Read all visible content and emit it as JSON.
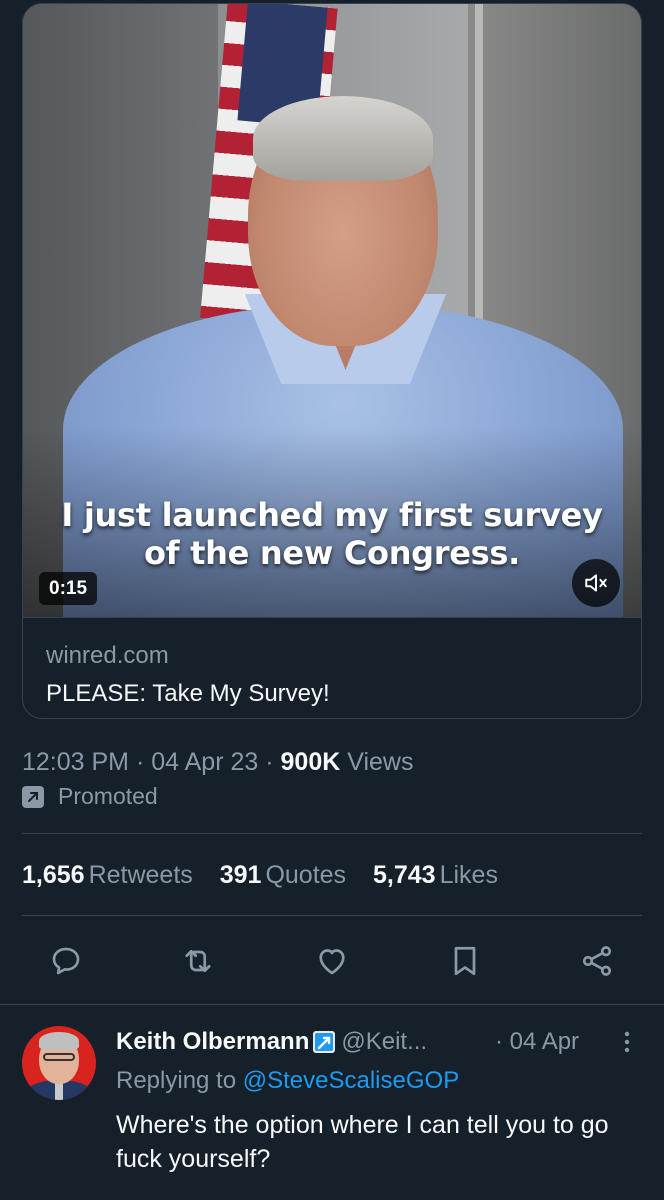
{
  "video": {
    "caption_line1": "I just launched my first survey",
    "caption_line2": "of the new Congress.",
    "duration": "0:15",
    "mute_icon": "speaker-muted-icon"
  },
  "link_card": {
    "domain": "winred.com",
    "title": "PLEASE: Take My Survey!"
  },
  "tweet_meta": {
    "time": "12:03 PM",
    "date": "04 Apr 23",
    "views_count": "900K",
    "views_label": "Views",
    "promoted_label": "Promoted"
  },
  "stats": [
    {
      "count": "1,656",
      "label": "Retweets"
    },
    {
      "count": "391",
      "label": "Quotes"
    },
    {
      "count": "5,743",
      "label": "Likes"
    }
  ],
  "actions": [
    "reply-icon",
    "retweet-icon",
    "like-icon",
    "bookmark-icon",
    "share-icon"
  ],
  "reply": {
    "name": "Keith Olbermann",
    "handle": "@Keit...",
    "date": "· 04 Apr",
    "replying_prefix": "Replying to",
    "replying_to": "@SteveScaliseGOP",
    "text": "Where's the option where I can tell you to go fuck yourself?"
  },
  "colors": {
    "background": "#15202b",
    "border": "#38444d",
    "muted_text": "#8b98a5",
    "link": "#1d9bf0"
  }
}
